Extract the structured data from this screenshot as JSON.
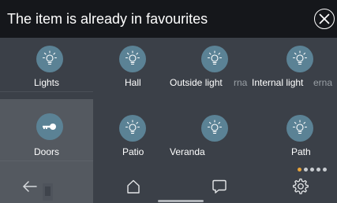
{
  "banner": {
    "message": "The item is already in favourites"
  },
  "sidebar": {
    "items": [
      {
        "label": "Lights",
        "icon": "bulb-icon",
        "active": false
      },
      {
        "label": "Doors",
        "icon": "key-icon",
        "active": true
      }
    ]
  },
  "grid": {
    "tiles": [
      {
        "label": "Hall",
        "icon": "bulb-icon"
      },
      {
        "label": "Outside light",
        "ghost": "rna",
        "icon": "bulb-icon"
      },
      {
        "label": "Internal light",
        "ghost": "erna",
        "icon": "bulb-icon"
      },
      {
        "label": "Patio",
        "icon": "bulb-icon"
      },
      {
        "label": "Veranda",
        "icon": "bulb-icon"
      },
      {
        "label": "Path",
        "icon": "bulb-icon"
      }
    ]
  },
  "pagination": {
    "current_page": 1,
    "total_pages": 5
  },
  "bottom_nav": {
    "items": [
      "back-icon",
      "home-icon",
      "message-icon",
      "settings-icon"
    ]
  },
  "colors": {
    "banner_bg": "#15171b",
    "background": "#3b4048",
    "active_item": "#545960",
    "icon_circle": "#5b8295",
    "dot_active": "#e8a33a"
  }
}
